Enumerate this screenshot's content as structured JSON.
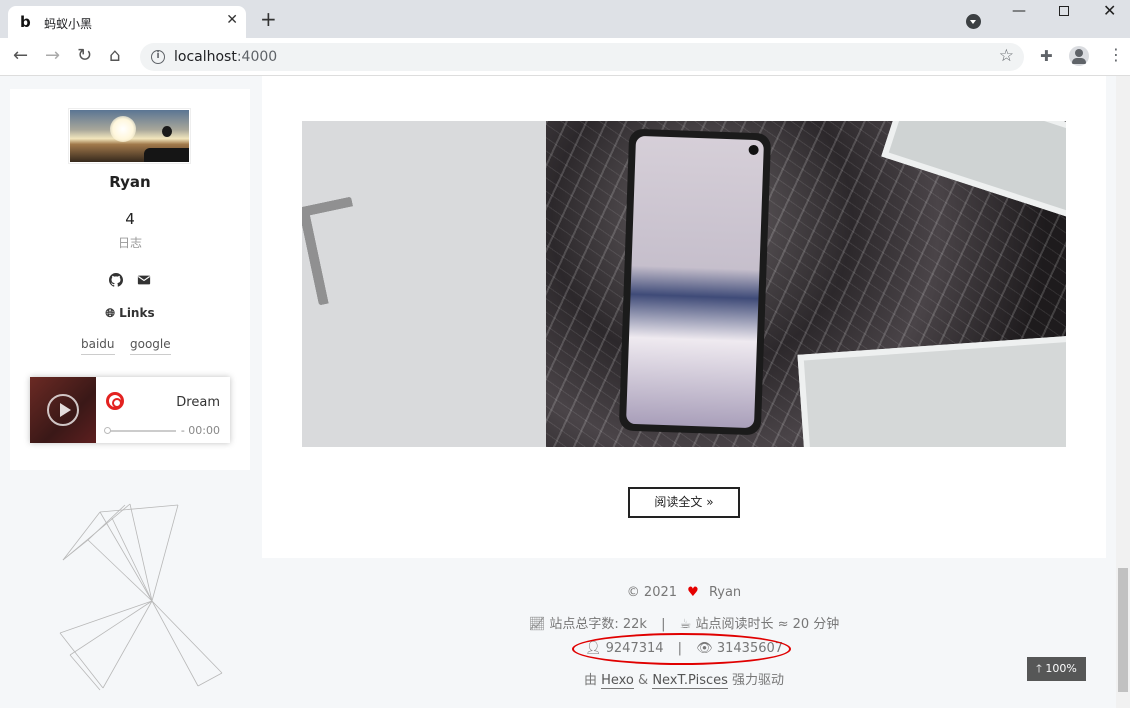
{
  "browser": {
    "tab_title": "蚂蚁小黑",
    "tab_favicon": "b",
    "url_host": "localhost",
    "url_port": ":4000",
    "icons": [
      "back-icon",
      "forward-icon",
      "reload-icon",
      "home-icon",
      "info-icon",
      "bookmark-star-icon",
      "extensions-icon",
      "profile-icon",
      "menu-icon",
      "tab-search-icon",
      "minimize-icon",
      "maximize-icon",
      "close-icon"
    ]
  },
  "sidebar": {
    "author": "Ryan",
    "posts_count": "4",
    "posts_label": "日志",
    "links_title": "Links",
    "links": [
      "baidu",
      "google"
    ],
    "player": {
      "song": "Dream",
      "time": "- 00:00",
      "progress": 0
    }
  },
  "post": {
    "read_more": "阅读全文 »"
  },
  "footer": {
    "copyright": "© 2021",
    "author": "Ryan",
    "word_count_label": "站点总字数:",
    "word_count": "22k",
    "read_time_label": "站点阅读时长 ≈",
    "read_time": "20 分钟",
    "visitors": "9247314",
    "views": "31435607",
    "powered_prefix": "由",
    "hexo": "Hexo",
    "amp": "&",
    "theme": "NexT.Pisces",
    "powered_suffix": "强力驱动"
  },
  "back_to_top": "100%",
  "colors": {
    "heart": "#e50000",
    "highlight": "#e00000",
    "netease": "#e32220"
  }
}
